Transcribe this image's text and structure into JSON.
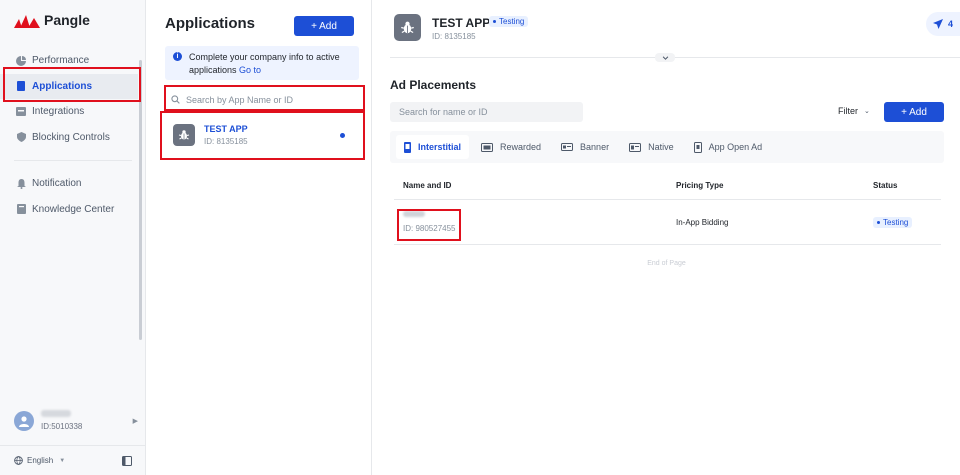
{
  "brand": {
    "name": "Pangle",
    "color": "#e0101d"
  },
  "sidebar": {
    "items": [
      {
        "label": "Performance",
        "icon": "pie-chart-icon"
      },
      {
        "label": "Applications",
        "icon": "app-icon"
      },
      {
        "label": "Integrations",
        "icon": "integrations-icon"
      },
      {
        "label": "Blocking Controls",
        "icon": "shield-icon"
      },
      {
        "label": "Notification",
        "icon": "bell-icon"
      },
      {
        "label": "Knowledge Center",
        "icon": "book-icon"
      }
    ],
    "user_id": "ID:5010338",
    "language": "English"
  },
  "apps_panel": {
    "title": "Applications",
    "add_label": "+ Add",
    "notice_text": "Complete your company info to active applications",
    "notice_link": "Go to",
    "search_placeholder": "Search by App Name or ID",
    "app": {
      "name": "TEST APP",
      "id": "ID: 8135185"
    }
  },
  "header": {
    "app_name": "TEST APP",
    "status": "Testing",
    "app_id": "ID: 8135185",
    "notif_count": "4"
  },
  "placements": {
    "title": "Ad Placements",
    "search_placeholder": "Search for name or ID",
    "filter_label": "Filter",
    "add_label": "+ Add",
    "tabs": [
      "Interstitial",
      "Rewarded",
      "Banner",
      "Native",
      "App Open Ad"
    ],
    "columns": [
      "Name and ID",
      "Pricing Type",
      "Status"
    ],
    "rows": [
      {
        "id": "ID: 980527455",
        "pricing": "In-App Bidding",
        "status": "Testing"
      }
    ],
    "end_text": "End of Page"
  },
  "colors": {
    "accent": "#1d4fd6",
    "highlight": "#e0101d"
  }
}
